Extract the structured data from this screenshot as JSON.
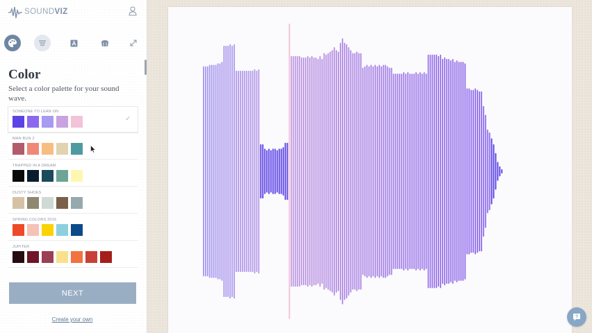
{
  "brand": {
    "name_light": "SOUND",
    "name_bold": "VIZ",
    "logo_icon": "waveform-logo-icon"
  },
  "header": {
    "user_icon": "user-icon"
  },
  "toolbar": {
    "items": [
      {
        "name": "palette",
        "icon": "palette-icon",
        "active": true
      },
      {
        "name": "lines",
        "icon": "lines-icon",
        "active": false
      },
      {
        "name": "text",
        "icon": "text-icon",
        "active": false
      },
      {
        "name": "shape",
        "icon": "shape-icon",
        "active": false
      },
      {
        "name": "resize",
        "icon": "resize-icon",
        "active": false
      }
    ]
  },
  "color_section": {
    "title": "Color",
    "description": "Select a color palette for your sound wave.",
    "palettes": [
      {
        "name": "SOMEONE TO LEAN ON",
        "selected": true,
        "colors": [
          "#5c43e6",
          "#8b69ee",
          "#a89af0",
          "#c9a2e0",
          "#f2c3d9"
        ]
      },
      {
        "name": "MAN BUN 2",
        "selected": false,
        "colors": [
          "#b15b6d",
          "#f08877",
          "#f8bd80",
          "#e1d2b0",
          "#4f9aa0"
        ]
      },
      {
        "name": "TRAPPED IN A DREAM",
        "selected": false,
        "colors": [
          "#0a0a0a",
          "#0a1d2e",
          "#1a4a5c",
          "#6ea496",
          "#fdf7b1"
        ]
      },
      {
        "name": "DUSTY SHOES",
        "selected": false,
        "colors": [
          "#d5c2a4",
          "#908770",
          "#d0dad5",
          "#7a6048",
          "#97a9ac"
        ]
      },
      {
        "name": "SPRING COLORS 2016",
        "selected": false,
        "colors": [
          "#ee4a29",
          "#f6c2b6",
          "#fad304",
          "#8cd0de",
          "#0d4a8a"
        ]
      },
      {
        "name": "JUPITER",
        "selected": false,
        "colors": [
          "#260c10",
          "#6f1529",
          "#9b3f54",
          "#fae08c",
          "#f27240",
          "#c84138",
          "#a51f1a"
        ]
      }
    ],
    "next_label": "NEXT",
    "create_label": "Create your own"
  },
  "help": {
    "icon": "help-icon"
  },
  "waveform": {
    "palette": [
      "#5c43e6",
      "#8b69ee",
      "#a89af0",
      "#c9a2e0",
      "#f2c3d9"
    ],
    "levels": [
      0.71,
      0.71,
      0.71,
      0.72,
      0.72,
      0.72,
      0.72,
      0.73,
      0.73,
      0.74,
      0.85,
      0.85,
      0.85,
      0.86,
      0.85,
      0.86,
      0.68,
      0.68,
      0.68,
      0.68,
      0.68,
      0.68,
      0.68,
      0.68,
      0.68,
      0.69,
      0.68,
      0.69,
      0.18,
      0.18,
      0.15,
      0.14,
      0.15,
      0.14,
      0.15,
      0.15,
      0.14,
      0.15,
      0.15,
      0.16,
      0.19,
      0.19,
      1.0,
      0.78,
      0.78,
      0.78,
      0.78,
      0.78,
      0.77,
      0.77,
      0.77,
      0.78,
      0.77,
      0.78,
      0.77,
      0.77,
      0.76,
      0.78,
      0.76,
      0.8,
      0.79,
      0.8,
      0.81,
      0.82,
      0.84,
      0.82,
      0.81,
      0.87,
      0.9,
      0.87,
      0.86,
      0.84,
      0.82,
      0.8,
      0.8,
      0.81,
      0.8,
      0.8,
      0.7,
      0.71,
      0.72,
      0.71,
      0.72,
      0.71,
      0.72,
      0.71,
      0.72,
      0.71,
      0.72,
      0.72,
      0.71,
      0.7,
      0.7,
      0.66,
      0.66,
      0.66,
      0.66,
      0.66,
      0.67,
      0.66,
      0.67,
      0.66,
      0.66,
      0.66,
      0.67,
      0.66,
      0.67,
      0.66,
      0.67,
      0.66,
      0.79,
      0.79,
      0.79,
      0.79,
      0.79,
      0.78,
      0.79,
      0.76,
      0.77,
      0.76,
      0.76,
      0.75,
      0.76,
      0.74,
      0.75,
      0.74,
      0.74,
      0.74,
      0.73,
      0.56,
      0.56,
      0.55,
      0.55,
      0.56,
      0.55,
      0.54,
      0.54,
      0.44,
      0.38,
      0.28,
      0.26,
      0.22,
      0.18,
      0.12,
      0.06,
      0.03,
      0.01
    ]
  }
}
